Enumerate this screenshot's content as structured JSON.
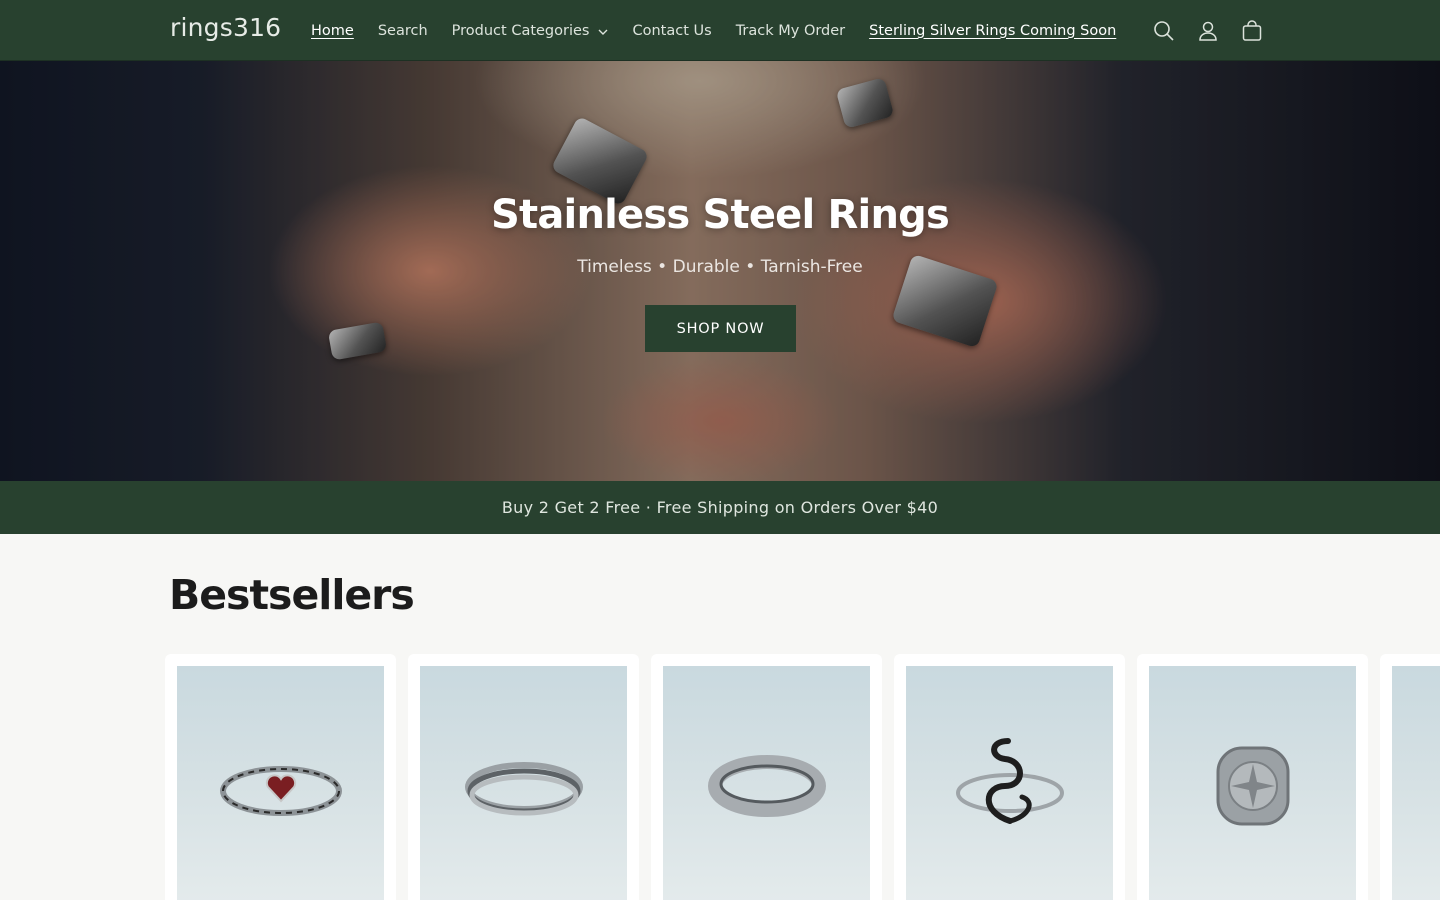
{
  "header": {
    "logo": "rings316",
    "nav": [
      {
        "label": "Home",
        "active": true
      },
      {
        "label": "Search"
      },
      {
        "label": "Product Categories",
        "dropdown": true
      },
      {
        "label": "Contact Us"
      },
      {
        "label": "Track My Order"
      },
      {
        "label": "Sterling Silver Rings Coming Soon",
        "underlined": true
      }
    ],
    "icons": [
      "search-icon",
      "account-icon",
      "cart-icon"
    ]
  },
  "hero": {
    "title": "Stainless Steel Rings",
    "subtitle": "Timeless • Durable • Tarnish-Free",
    "button": "SHOP NOW"
  },
  "announcement": "Buy 2 Get 2 Free · Free Shipping on Orders Over $40",
  "bestsellers": {
    "title": "Bestsellers",
    "products": [
      {
        "image": "heart-gem-ring"
      },
      {
        "image": "interlocked-band-ring"
      },
      {
        "image": "plain-band-ring"
      },
      {
        "image": "swirl-ring"
      },
      {
        "image": "compass-signet-ring"
      },
      {
        "image": "partial-ring"
      }
    ]
  },
  "colors": {
    "brand": "#28412f",
    "background": "#f7f7f5",
    "accent_text": "#ffffff"
  }
}
